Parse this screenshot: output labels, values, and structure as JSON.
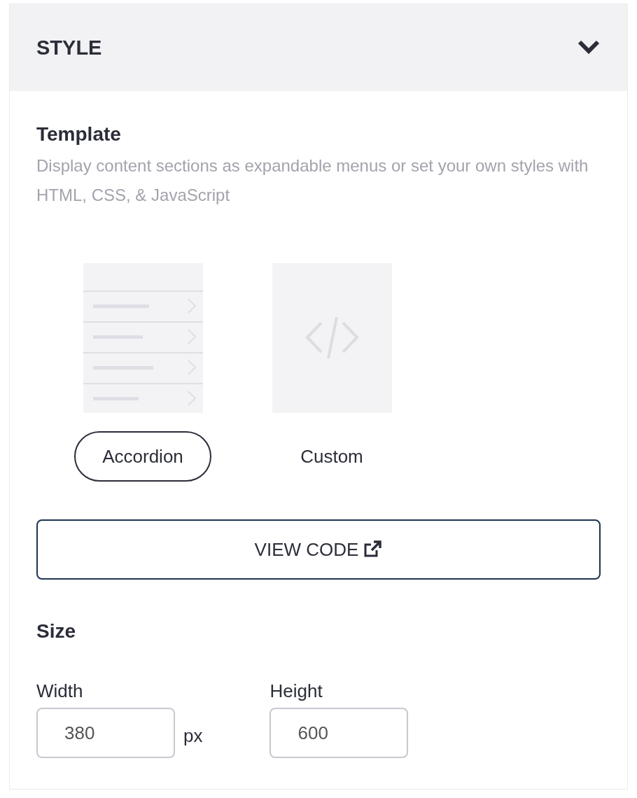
{
  "section": {
    "title": "STYLE",
    "expanded": true
  },
  "template": {
    "heading": "Template",
    "description": "Display content sections as expandable menus or set your own styles with HTML, CSS, & JavaScript",
    "options": [
      {
        "kind": "accordion",
        "label": "Accordion",
        "selected": true
      },
      {
        "kind": "custom",
        "label": "Custom",
        "selected": false
      }
    ]
  },
  "view_code_button": "VIEW CODE",
  "size": {
    "heading": "Size",
    "fields": [
      {
        "label": "Width",
        "value": "380",
        "unit": "px"
      },
      {
        "label": "Height",
        "value": "600"
      }
    ]
  }
}
